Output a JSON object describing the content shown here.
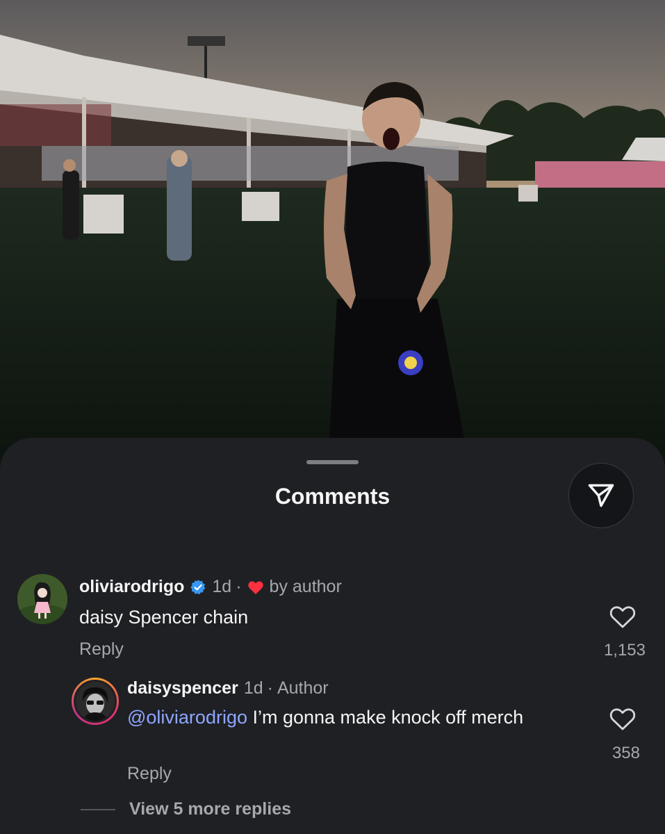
{
  "sheet": {
    "title": "Comments",
    "share_icon": "send-icon"
  },
  "comments": [
    {
      "username": "oliviarodrigo",
      "verified": true,
      "time": "1d",
      "liked_by_author_label": "by author",
      "text": "daisy Spencer chain",
      "reply_label": "Reply",
      "like_count": "1,153",
      "replies": [
        {
          "username": "daisyspencer",
          "time": "1d",
          "role_label": "Author",
          "mention": "@oliviarodrigo",
          "text": " I’m gonna make knock off merch",
          "reply_label": "Reply",
          "like_count": "358"
        }
      ],
      "view_more_label": "View 5 more replies"
    }
  ],
  "colors": {
    "sheet_bg": "#1f2024",
    "mention": "#8fa6ff",
    "heart_red": "#ff3040",
    "verified_blue": "#3897f0"
  }
}
